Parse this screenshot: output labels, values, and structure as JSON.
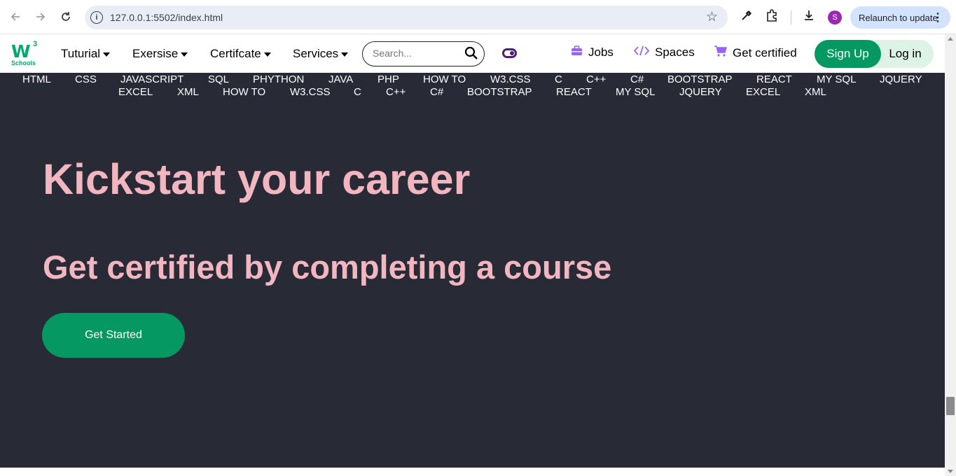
{
  "browser": {
    "url": "127.0.0.1:5502/index.html",
    "profile_initial": "S",
    "relaunch_label": "Relaunch to update",
    "icons": [
      "back-arrow-icon",
      "forward-arrow-icon",
      "reload-icon",
      "site-info-icon",
      "bookmark-star-icon",
      "eyedropper-icon",
      "extensions-icon",
      "download-icon",
      "more-menu-icon"
    ]
  },
  "navbar": {
    "logo": {
      "mark": "W",
      "superscript": "3",
      "text": "Schools"
    },
    "menus": [
      {
        "label": "Tuturial"
      },
      {
        "label": "Exersise"
      },
      {
        "label": "Certifcate"
      },
      {
        "label": "Services"
      }
    ],
    "search": {
      "placeholder": "Search...",
      "value": ""
    },
    "jobs_label": "Jobs",
    "spaces_label": "Spaces",
    "get_certified_label": "Get certified",
    "signup_label": "Sign Up",
    "login_label": "Log in"
  },
  "subnav": {
    "row1": [
      "HTML",
      "CSS",
      "JAVASCRIPT",
      "SQL",
      "PHYTHON",
      "JAVA",
      "PHP",
      "HOW TO",
      "W3.CSS",
      "C",
      "C++",
      "C#",
      "BOOTSTRAP",
      "REACT",
      "MY SQL",
      "JQUERY"
    ],
    "row2": [
      "EXCEL",
      "XML",
      "HOW TO",
      "W3.CSS",
      "C",
      "C++",
      "C#",
      "BOOTSTRAP",
      "REACT",
      "MY SQL",
      "JQUERY",
      "EXCEL",
      "XML"
    ]
  },
  "hero": {
    "title": "Kickstart your career",
    "subtitle": "Get certified by completing a course",
    "cta_label": "Get Started"
  },
  "colors": {
    "brand_green": "#04aa6d",
    "dark_bg": "#282a35",
    "hero_pink": "#f2b6c0",
    "accent_purple": "#9763f6"
  }
}
